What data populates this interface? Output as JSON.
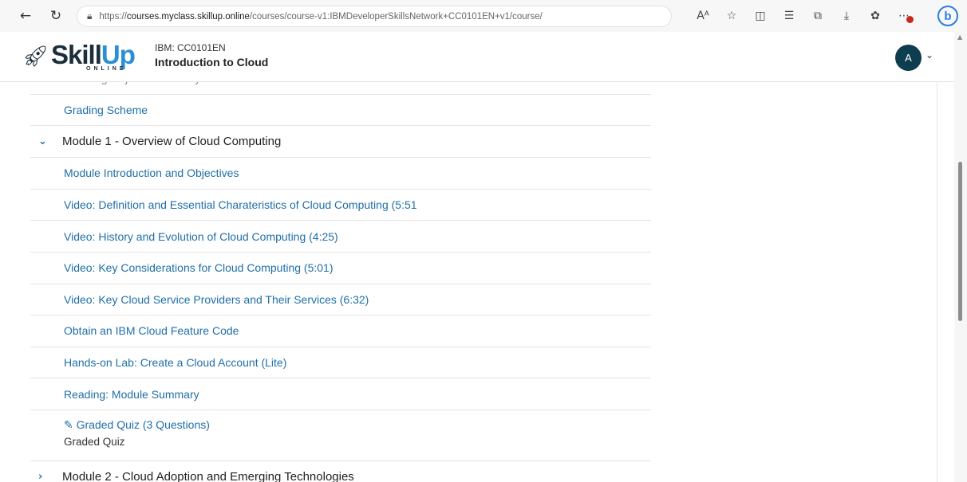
{
  "browser": {
    "url_prefix": "https://",
    "url_host": "courses.myclass.skillup.online",
    "url_path": "/courses/course-v1:IBMDeveloperSkillsNetwork+CC0101EN+v1/course/"
  },
  "header": {
    "logo_skill": "Skill",
    "logo_up": "Up",
    "logo_online": "ONLINE",
    "course_id": "IBM: CC0101EN",
    "course_title": "Introduction to Cloud",
    "avatar_initial": "A"
  },
  "outline": {
    "partial_item": "Learning Objectives and Syllabus",
    "grading": "Grading Scheme",
    "module1": {
      "title": "Module 1 - Overview of Cloud Computing",
      "items": [
        "Module Introduction and Objectives",
        "Video: Definition and Essential Charateristics of Cloud Computing (5:51",
        "Video: History and Evolution of Cloud Computing (4:25)",
        "Video: Key Considerations for Cloud Computing (5:01)",
        "Video: Key Cloud Service Providers and Their Services (6:32)",
        "Obtain an IBM Cloud Feature Code",
        "Hands-on Lab: Create a Cloud Account (Lite)",
        "Reading: Module Summary"
      ],
      "quiz_title": "Graded Quiz (3 Questions)",
      "quiz_subtitle": "Graded Quiz"
    },
    "module2": {
      "title": "Module 2 - Cloud Adoption and Emerging Technologies"
    }
  }
}
